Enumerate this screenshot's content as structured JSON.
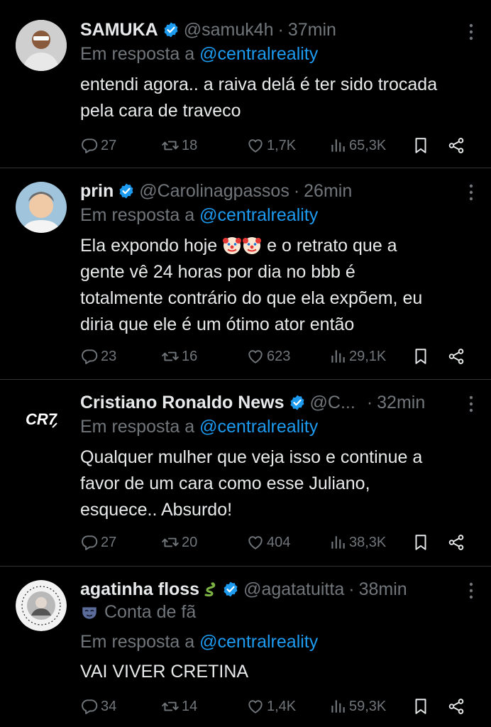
{
  "colors": {
    "accent": "#1d9bf0",
    "muted": "#71767b",
    "text": "#e7e9ea",
    "bg": "#000000"
  },
  "tweets": [
    {
      "name": "SAMUKA",
      "verified": true,
      "handle": "@samuk4h",
      "time": "37min",
      "reply_prefix": "Em resposta a",
      "reply_to": "@centralreality",
      "text_lines": [
        "entendi agora.. a raiva delá é ter sido trocada",
        "pela cara de traveco"
      ],
      "replies": "27",
      "retweets": "18",
      "likes": "1,7K",
      "views": "65,3K"
    },
    {
      "name": "prin",
      "verified": true,
      "handle": "@Carolinagpassos",
      "time": "26min",
      "reply_prefix": "Em resposta a",
      "reply_to": "@centralreality",
      "text_pre": "Ela expondo hoje",
      "text_post": "e o retrato que a",
      "text_lines": [
        "gente vê 24 horas por dia no bbb é",
        "totalmente contrário do que ela expõem, eu",
        "diria que ele é um ótimo ator então"
      ],
      "emoji": "clown-face",
      "replies": "23",
      "retweets": "16",
      "likes": "623",
      "views": "29,1K"
    },
    {
      "name": "Cristiano Ronaldo News",
      "verified": true,
      "handle": "@C...",
      "time": "32min",
      "avatar_text": "CR7",
      "reply_prefix": "Em resposta a",
      "reply_to": "@centralreality",
      "text_lines": [
        "Qualquer mulher que veja isso e continue a",
        "favor de um cara como esse Juliano,",
        "esquece.. Absurdo!"
      ],
      "replies": "27",
      "retweets": "20",
      "likes": "404",
      "views": "38,3K"
    },
    {
      "name": "agatinha floss",
      "name_emoji": "snake",
      "verified": true,
      "handle": "@agatatuitta",
      "time": "38min",
      "fan_label": "Conta de fã",
      "reply_prefix": "Em resposta a",
      "reply_to": "@centralreality",
      "text_lines": [
        "VAI VIVER CRETINA"
      ],
      "replies": "34",
      "retweets": "14",
      "likes": "1,4K",
      "views": "59,3K"
    }
  ]
}
